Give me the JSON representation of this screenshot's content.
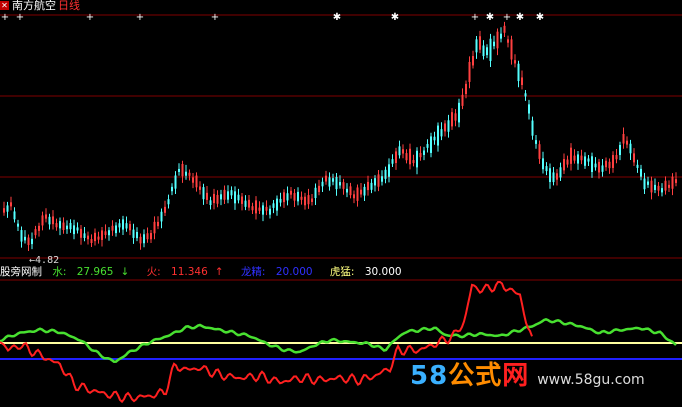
{
  "header": {
    "close_symbol": "✕",
    "stock_name": "南方航空",
    "period": "日线"
  },
  "price_panel": {
    "low_marker": "4.82"
  },
  "indicator": {
    "name": "股旁网制",
    "water_label": "水:",
    "water_value": "27.965",
    "water_arrow": "↓",
    "fire_label": "火:",
    "fire_value": "11.346",
    "fire_arrow": "↑",
    "dragon_label": "龙精:",
    "dragon_value": "20.000",
    "tiger_label": "虎猛:",
    "tiger_value": "30.000"
  },
  "signal_markers": [
    "+",
    "+",
    "+",
    "+",
    "+",
    "✱",
    "✱",
    "+",
    "✱",
    "+",
    "✱",
    "✱"
  ],
  "colors": {
    "background": "#000000",
    "candle_up": "#ff4040",
    "candle_down": "#54ffff",
    "gridline": "#800000",
    "water_line": "#48e030",
    "fire_line": "#ff2020",
    "dragon_line": "#2020ff",
    "tiger_line": "#ffffa0"
  },
  "watermark": {
    "num": "58",
    "cn": "公式",
    "net": "网",
    "url": "www.58gu.com"
  }
}
